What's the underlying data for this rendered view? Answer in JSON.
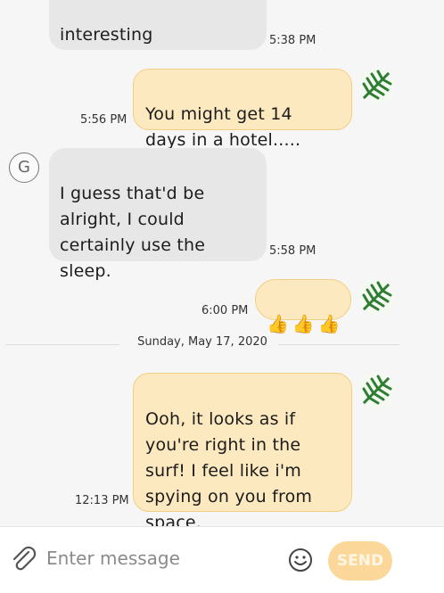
{
  "messages": [
    {
      "direction": "in",
      "text": "interesting",
      "time": "5:38 PM"
    },
    {
      "direction": "out",
      "text": "You might get 14\ndays in a hotel.....",
      "time": "5:56 PM"
    },
    {
      "direction": "in",
      "sender_initial": "G",
      "text": "I guess that'd be\nalright, I could\ncertainly use the\nsleep.",
      "time": "5:58 PM"
    },
    {
      "direction": "out",
      "text": "👍👍👍",
      "time": "6:00 PM"
    },
    {
      "direction": "out",
      "text": "Ooh, it looks as if\nyou're right in the\nsurf! I feel like i'm\nspying on you from\nspace.",
      "time": "12:13 PM"
    }
  ],
  "date_separator": "Sunday, May 17, 2020",
  "composer": {
    "placeholder": "Enter message",
    "send_label": "SEND",
    "attach_icon": "paperclip-icon",
    "emoji_icon": "smiley-icon"
  },
  "colors": {
    "incoming_bubble": "#e7e7e7",
    "outgoing_bubble": "#fde9bf",
    "outgoing_border": "#f3cf86",
    "send_button": "#fbd89a",
    "background": "#f6f6f6"
  }
}
